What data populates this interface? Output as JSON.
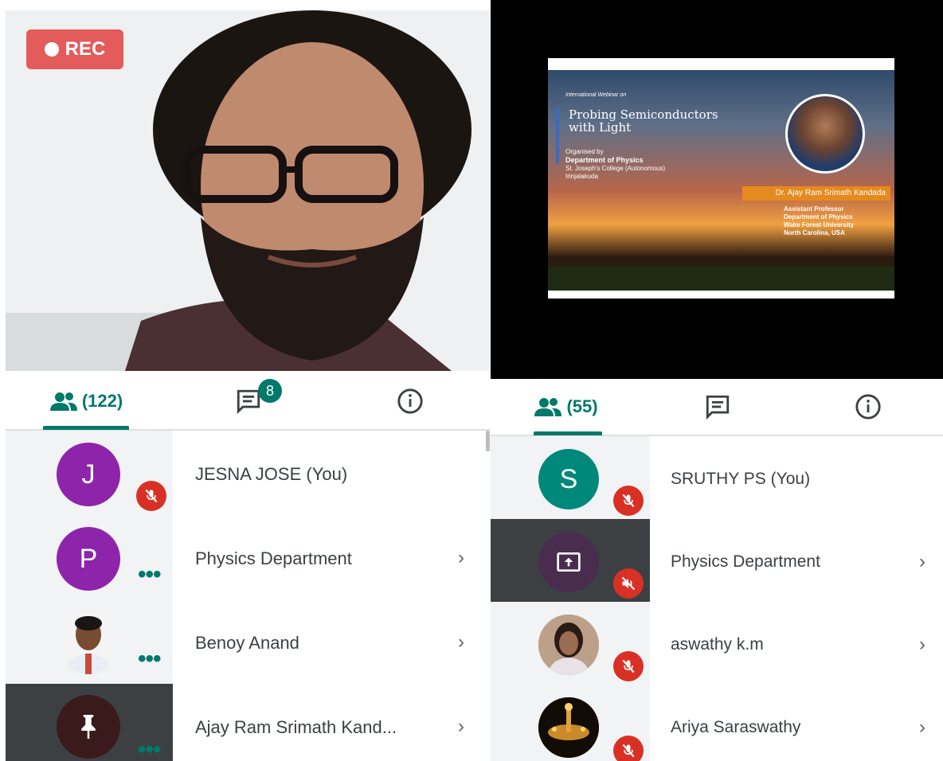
{
  "left": {
    "rec_label": "REC",
    "tabs": {
      "people_count": "(122)",
      "chat_badge": "8"
    },
    "participants": [
      {
        "initial": "J",
        "name": "JESNA JOSE (You)",
        "avatar_color": "#8e24aa",
        "status": "muted"
      },
      {
        "initial": "P",
        "name": "Physics Department",
        "avatar_color": "#8e24aa",
        "status": "more"
      },
      {
        "initial": "",
        "name": "Benoy Anand",
        "avatar_color": "#ffffff",
        "status": "more"
      },
      {
        "initial": "",
        "name": "Ajay Ram Srimath Kand...",
        "avatar_color": "#3b1a1c",
        "status": "more"
      }
    ]
  },
  "right": {
    "slide": {
      "kicker": "International Webinar on",
      "title": "Probing Semiconductors with Light",
      "org_line1": "Organised by",
      "org_line2": "Department of Physics",
      "org_line3": "St. Joseph's College (Autonomous)",
      "org_line4": "Irinjalakuda",
      "speaker": "Dr. Ajay Ram Srimath Kandada",
      "role1": "Assistant Professor",
      "role2": "Department of Physics",
      "role3": "Wake Forest University",
      "role4": "North Carolina, USA"
    },
    "tabs": {
      "people_count": "(55)"
    },
    "participants": [
      {
        "initial": "S",
        "name": "SRUTHY PS (You)",
        "avatar_color": "#00897b",
        "status": "muted"
      },
      {
        "initial": "",
        "name": "Physics Department",
        "avatar_color": "#4a2c4f",
        "status": "muted"
      },
      {
        "initial": "",
        "name": "aswathy k.m",
        "avatar_color": "#c9a992",
        "status": "muted"
      },
      {
        "initial": "",
        "name": "Ariya Saraswathy",
        "avatar_color": "#1a1208",
        "status": "muted"
      }
    ]
  },
  "colors": {
    "accent": "#00796b",
    "mute_red": "#d93025",
    "rec_red": "#e35b5b"
  }
}
